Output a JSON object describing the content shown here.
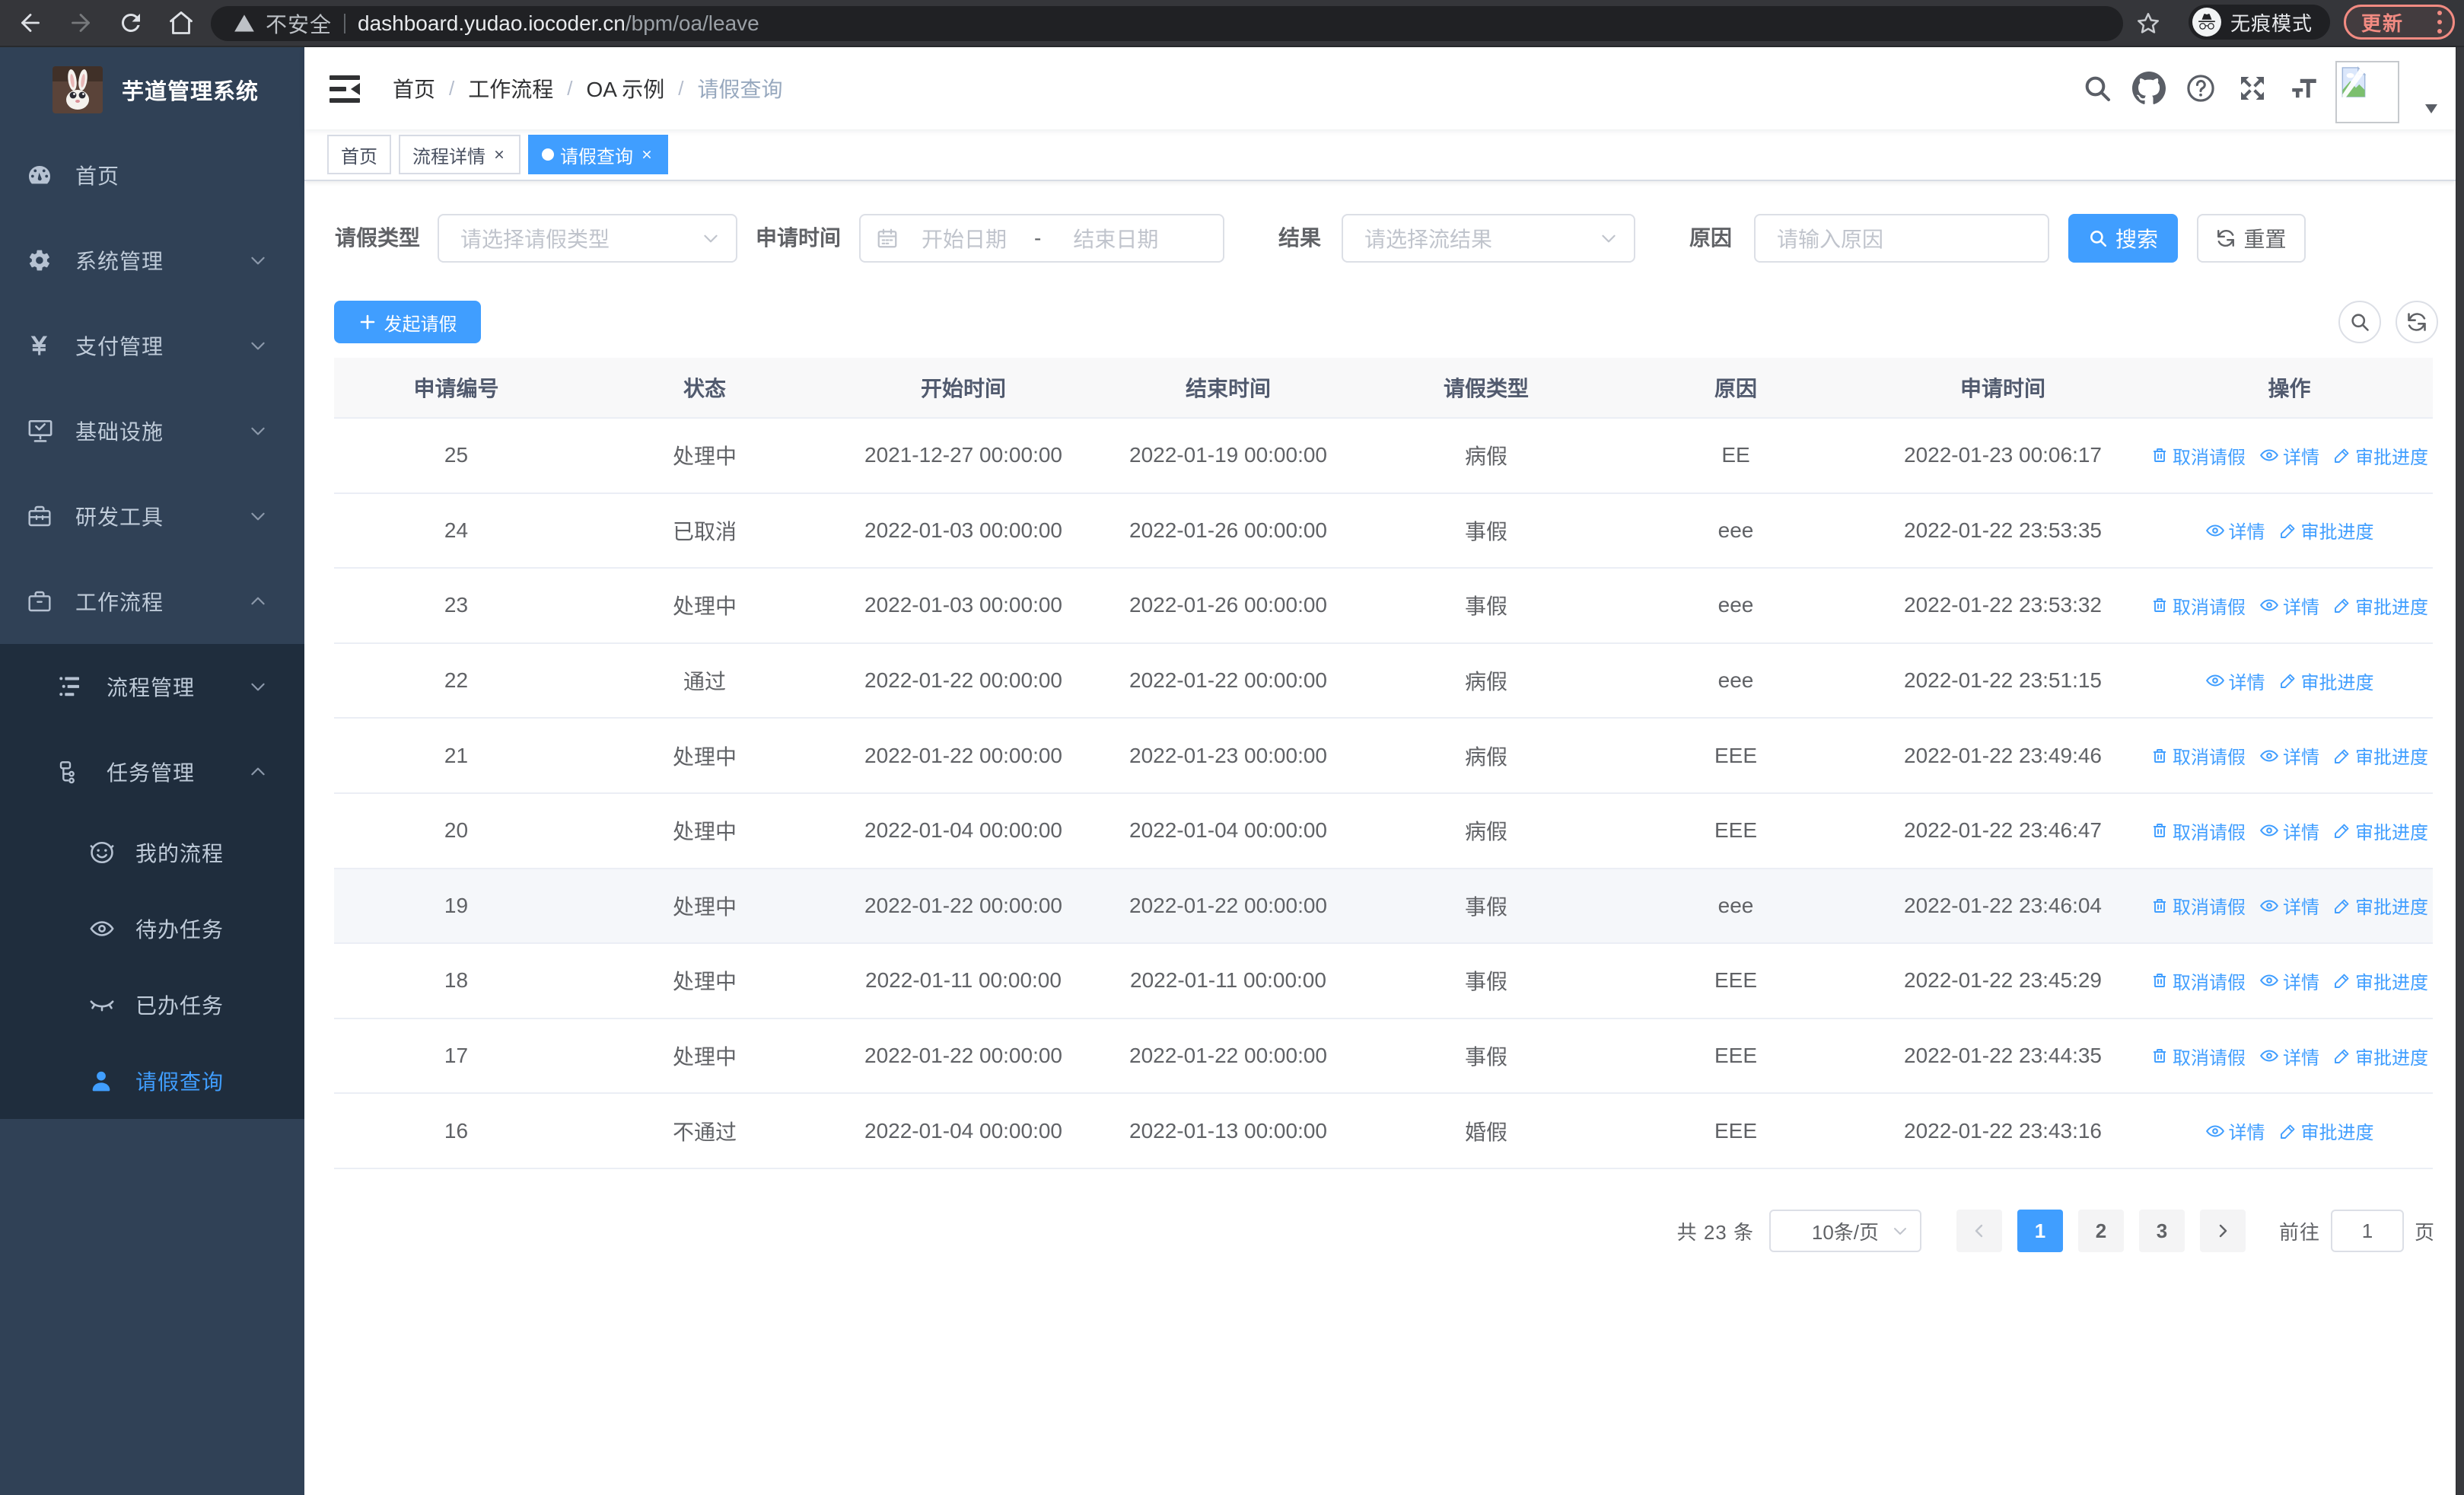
{
  "colors": {
    "accent": "#409eff",
    "sidebar_bg": "#304156",
    "submenu_bg": "#1f2d3d",
    "update_accent": "#f28b82"
  },
  "browser": {
    "security_label": "不安全",
    "url_host": "dashboard.yudao.iocoder.cn",
    "url_path": "/bpm/oa/leave",
    "incognito_label": "无痕模式",
    "update_label": "更新"
  },
  "sidebar": {
    "logo_title": "芋道管理系统",
    "menu": [
      {
        "label": "首页",
        "icon": "dashboard-icon",
        "level": 1,
        "arrow": "",
        "active": false
      },
      {
        "label": "系统管理",
        "icon": "gear-icon",
        "level": 1,
        "arrow": "down",
        "active": false
      },
      {
        "label": "支付管理",
        "icon": "yen-icon",
        "level": 1,
        "arrow": "down",
        "active": false
      },
      {
        "label": "基础设施",
        "icon": "monitor-icon",
        "level": 1,
        "arrow": "down",
        "active": false
      },
      {
        "label": "研发工具",
        "icon": "toolbox-icon",
        "level": 1,
        "arrow": "down",
        "active": false
      },
      {
        "label": "工作流程",
        "icon": "briefcase-icon",
        "level": 1,
        "arrow": "up",
        "active": false
      },
      {
        "label": "流程管理",
        "icon": "list-tree-icon",
        "level": 2,
        "arrow": "down",
        "active": false
      },
      {
        "label": "任务管理",
        "icon": "org-tree-icon",
        "level": 2,
        "arrow": "up",
        "active": false
      },
      {
        "label": "我的流程",
        "icon": "face-icon",
        "level": 3,
        "arrow": "",
        "active": false
      },
      {
        "label": "待办任务",
        "icon": "eye-open-icon",
        "level": 3,
        "arrow": "",
        "active": false
      },
      {
        "label": "已办任务",
        "icon": "eye-closed-icon",
        "level": 3,
        "arrow": "",
        "active": false
      },
      {
        "label": "请假查询",
        "icon": "user-icon",
        "level": 3,
        "arrow": "",
        "active": true
      }
    ]
  },
  "header": {
    "breadcrumb": [
      {
        "label": "首页",
        "current": false
      },
      {
        "label": "工作流程",
        "current": false
      },
      {
        "label": "OA 示例",
        "current": false
      },
      {
        "label": "请假查询",
        "current": true
      }
    ]
  },
  "tabs": [
    {
      "label": "首页",
      "closable": false,
      "active": false
    },
    {
      "label": "流程详情",
      "closable": true,
      "active": false
    },
    {
      "label": "请假查询",
      "closable": true,
      "active": true
    }
  ],
  "filters": {
    "type_label": "请假类型",
    "type_placeholder": "请选择请假类型",
    "time_label": "申请时间",
    "date_start_placeholder": "开始日期",
    "date_separator": "-",
    "date_end_placeholder": "结束日期",
    "result_label": "结果",
    "result_placeholder": "请选择流结果",
    "reason_label": "原因",
    "reason_placeholder": "请输入原因",
    "search_label": "搜索",
    "reset_label": "重置"
  },
  "toolbar": {
    "create_label": "发起请假"
  },
  "action_labels": {
    "cancel": "取消请假",
    "detail": "详情",
    "progress": "审批进度"
  },
  "table": {
    "columns": [
      "申请编号",
      "状态",
      "开始时间",
      "结束时间",
      "请假类型",
      "原因",
      "申请时间",
      "操作"
    ],
    "rows": [
      {
        "id": "25",
        "status": "处理中",
        "start": "2021-12-27 00:00:00",
        "end": "2022-01-19 00:00:00",
        "type": "病假",
        "reason": "EE",
        "applied": "2022-01-23 00:06:17",
        "actions": [
          "cancel",
          "detail",
          "progress"
        ],
        "highlight": false
      },
      {
        "id": "24",
        "status": "已取消",
        "start": "2022-01-03 00:00:00",
        "end": "2022-01-26 00:00:00",
        "type": "事假",
        "reason": "eee",
        "applied": "2022-01-22 23:53:35",
        "actions": [
          "detail",
          "progress"
        ],
        "highlight": false
      },
      {
        "id": "23",
        "status": "处理中",
        "start": "2022-01-03 00:00:00",
        "end": "2022-01-26 00:00:00",
        "type": "事假",
        "reason": "eee",
        "applied": "2022-01-22 23:53:32",
        "actions": [
          "cancel",
          "detail",
          "progress"
        ],
        "highlight": false
      },
      {
        "id": "22",
        "status": "通过",
        "start": "2022-01-22 00:00:00",
        "end": "2022-01-22 00:00:00",
        "type": "病假",
        "reason": "eee",
        "applied": "2022-01-22 23:51:15",
        "actions": [
          "detail",
          "progress"
        ],
        "highlight": false
      },
      {
        "id": "21",
        "status": "处理中",
        "start": "2022-01-22 00:00:00",
        "end": "2022-01-23 00:00:00",
        "type": "病假",
        "reason": "EEE",
        "applied": "2022-01-22 23:49:46",
        "actions": [
          "cancel",
          "detail",
          "progress"
        ],
        "highlight": false
      },
      {
        "id": "20",
        "status": "处理中",
        "start": "2022-01-04 00:00:00",
        "end": "2022-01-04 00:00:00",
        "type": "病假",
        "reason": "EEE",
        "applied": "2022-01-22 23:46:47",
        "actions": [
          "cancel",
          "detail",
          "progress"
        ],
        "highlight": false
      },
      {
        "id": "19",
        "status": "处理中",
        "start": "2022-01-22 00:00:00",
        "end": "2022-01-22 00:00:00",
        "type": "事假",
        "reason": "eee",
        "applied": "2022-01-22 23:46:04",
        "actions": [
          "cancel",
          "detail",
          "progress"
        ],
        "highlight": true
      },
      {
        "id": "18",
        "status": "处理中",
        "start": "2022-01-11 00:00:00",
        "end": "2022-01-11 00:00:00",
        "type": "事假",
        "reason": "EEE",
        "applied": "2022-01-22 23:45:29",
        "actions": [
          "cancel",
          "detail",
          "progress"
        ],
        "highlight": false
      },
      {
        "id": "17",
        "status": "处理中",
        "start": "2022-01-22 00:00:00",
        "end": "2022-01-22 00:00:00",
        "type": "事假",
        "reason": "EEE",
        "applied": "2022-01-22 23:44:35",
        "actions": [
          "cancel",
          "detail",
          "progress"
        ],
        "highlight": false
      },
      {
        "id": "16",
        "status": "不通过",
        "start": "2022-01-04 00:00:00",
        "end": "2022-01-13 00:00:00",
        "type": "婚假",
        "reason": "EEE",
        "applied": "2022-01-22 23:43:16",
        "actions": [
          "detail",
          "progress"
        ],
        "highlight": false
      }
    ]
  },
  "pagination": {
    "total_label": "共 23 条",
    "page_size_label": "10条/页",
    "pages": [
      "1",
      "2",
      "3"
    ],
    "active_page": "1",
    "goto_label": "前往",
    "goto_value": "1",
    "page_suffix": "页"
  }
}
